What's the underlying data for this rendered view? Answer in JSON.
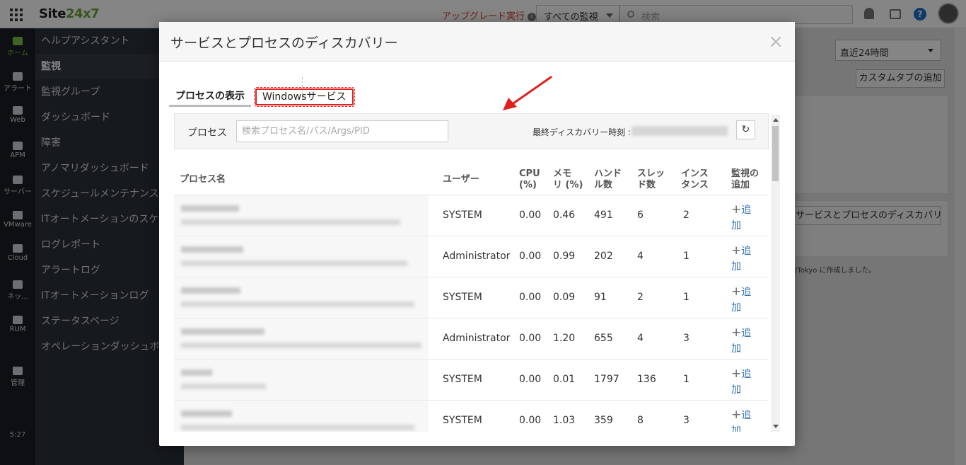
{
  "app": {
    "logo_main": "Site",
    "logo_accent": "24x7",
    "upgrade_label": "アップグレード実行",
    "monitor_select": "すべての監視",
    "search_placeholder": "検索"
  },
  "leftnav": [
    {
      "label": "ホーム",
      "icon": "home-icon",
      "active": true
    },
    {
      "label": "アラート",
      "icon": "bell-icon"
    },
    {
      "label": "Web",
      "icon": "globe-icon"
    },
    {
      "label": "APM",
      "icon": "apm-icon"
    },
    {
      "label": "サーバー",
      "icon": "server-icon"
    },
    {
      "label": "VMware",
      "icon": "vmware-icon"
    },
    {
      "label": "Cloud",
      "icon": "cloud-icon"
    },
    {
      "label": "ネッ...",
      "icon": "network-icon"
    },
    {
      "label": "RUM",
      "icon": "rum-icon"
    },
    {
      "label": "管理",
      "icon": "gear-icon"
    }
  ],
  "clock": "5:27",
  "sidemenu": [
    {
      "label": "ヘルプアシスタント"
    },
    {
      "label": "監視",
      "active": true
    },
    {
      "label": "監視グループ"
    },
    {
      "label": "ダッシュボード"
    },
    {
      "label": "障害"
    },
    {
      "label": "アノマリダッシュボード"
    },
    {
      "label": "スケジュールメンテナンス"
    },
    {
      "label": "ITオートメーションのスケ..."
    },
    {
      "label": "ログレポート"
    },
    {
      "label": "アラートログ"
    },
    {
      "label": "ITオートメーションログ"
    },
    {
      "label": "ステータスページ"
    },
    {
      "label": "オペレーションダッシュボ..."
    }
  ],
  "background": {
    "period": "直近24時間",
    "add_custom_tab": "カスタムタブの追加",
    "discovery_button": "サービスとプロセスのディスカバリー",
    "note": "/Tokyo に作成しました。"
  },
  "modal": {
    "title": "サービスとプロセスのディスカバリー",
    "close": "×",
    "tab_process": "プロセスの表示",
    "tab_windows": "Windowsサービス",
    "filter_label": "プロセス",
    "filter_placeholder": "検索プロセス名/パス/Args/PID",
    "last_discovery_label": "最終ディスカバリー時刻 :",
    "refresh": "↻",
    "columns": {
      "name": "プロセス名",
      "user": "ユーザー",
      "cpu1": "CPU",
      "cpu2": "(%)",
      "mem1": "メモ",
      "mem2": "リ (%)",
      "handle1": "ハンド",
      "handle2": "ル数",
      "thread1": "スレッ",
      "thread2": "ド数",
      "inst1": "インス",
      "inst2": "タンス",
      "add1": "監視の",
      "add2": "追加"
    },
    "add_label": "追",
    "add_label2": "加",
    "rows": [
      {
        "user": "SYSTEM",
        "cpu": "0.00",
        "mem": "0.46",
        "handles": "491",
        "threads": "6",
        "instances": "2"
      },
      {
        "user": "Administrator",
        "cpu": "0.00",
        "mem": "0.99",
        "handles": "202",
        "threads": "4",
        "instances": "1"
      },
      {
        "user": "SYSTEM",
        "cpu": "0.00",
        "mem": "0.09",
        "handles": "91",
        "threads": "2",
        "instances": "1"
      },
      {
        "user": "Administrator",
        "cpu": "0.00",
        "mem": "1.20",
        "handles": "655",
        "threads": "4",
        "instances": "3"
      },
      {
        "user": "SYSTEM",
        "cpu": "0.00",
        "mem": "0.01",
        "handles": "1797",
        "threads": "136",
        "instances": "1"
      },
      {
        "user": "SYSTEM",
        "cpu": "0.00",
        "mem": "1.03",
        "handles": "359",
        "threads": "8",
        "instances": "3"
      }
    ]
  },
  "colors": {
    "accent_green": "#7cc04a",
    "highlight_red": "#e02020",
    "link_blue": "#2f73b5"
  }
}
